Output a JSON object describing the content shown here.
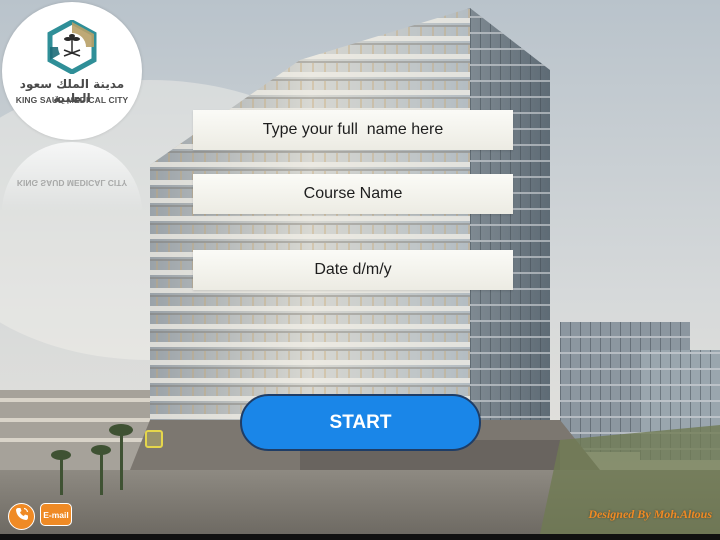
{
  "logo": {
    "arabic_name": "مدينة الملك سعود الطبية",
    "english_name": "KING SAUD MEDICAL CITY",
    "reflection_text": "KING SAUD MEDICAL CITY"
  },
  "form": {
    "name_placeholder": "Type your full  name here",
    "course_placeholder": "Course Name",
    "date_placeholder": "Date d/m/y",
    "start_label": "START"
  },
  "footer": {
    "email_label": "E-mail",
    "credit": "Designed By Moh.Altous"
  },
  "icons": {
    "logo_mark": "palm-swords-emblem-icon",
    "phone": "phone-icon"
  },
  "colors": {
    "start_button": "#1a86e8",
    "accent_orange": "#ef8a25",
    "logo_teal": "#2f8f98"
  }
}
